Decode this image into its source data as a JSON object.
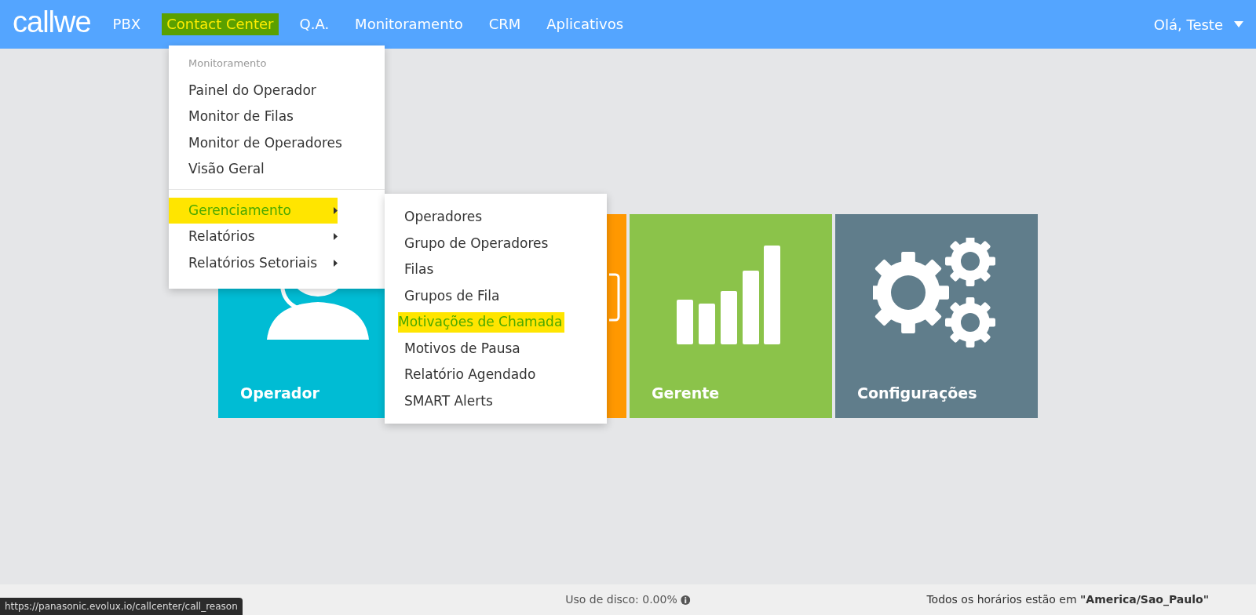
{
  "navbar": {
    "brand": "callwe",
    "items": [
      {
        "label": "PBX",
        "selected": false
      },
      {
        "label": "Contact Center",
        "selected": true
      },
      {
        "label": "Q.A.",
        "selected": false
      },
      {
        "label": "Monitoramento",
        "selected": false
      },
      {
        "label": "CRM",
        "selected": false
      },
      {
        "label": "Aplicativos",
        "selected": false
      }
    ],
    "user": "Olá, Teste"
  },
  "menu": {
    "header": "Monitoramento",
    "items": [
      {
        "label": "Painel do Operador",
        "selected": false,
        "submenu": false
      },
      {
        "label": "Monitor de Filas",
        "selected": false,
        "submenu": false
      },
      {
        "label": "Monitor de Operadores",
        "selected": false,
        "submenu": false
      },
      {
        "label": "Visão Geral",
        "selected": false,
        "submenu": false
      }
    ],
    "groups": [
      {
        "label": "Gerenciamento",
        "selected": true,
        "submenu": true
      },
      {
        "label": "Relatórios",
        "selected": false,
        "submenu": true
      },
      {
        "label": "Relatórios Setoriais",
        "selected": false,
        "submenu": true
      }
    ]
  },
  "submenu": {
    "items": [
      {
        "label": "Operadores",
        "selected": false
      },
      {
        "label": "Grupo de Operadores",
        "selected": false
      },
      {
        "label": "Filas",
        "selected": false
      },
      {
        "label": "Grupos de Fila",
        "selected": false
      },
      {
        "label": "Motivações de Chamada",
        "selected": true
      },
      {
        "label": "Motivos de Pausa",
        "selected": false
      },
      {
        "label": "Relatório Agendado",
        "selected": false
      },
      {
        "label": "SMART Alerts",
        "selected": false
      }
    ]
  },
  "tiles": [
    {
      "kind": "operator",
      "label": "Operador",
      "color": "#00bcd4"
    },
    {
      "kind": "screen",
      "color": "#ff9800"
    },
    {
      "kind": "chart",
      "label": "Gerente",
      "color": "#8bc34a"
    },
    {
      "kind": "gears",
      "label": "Configurações",
      "color": "#607d8b"
    }
  ],
  "footer": {
    "disk": "Uso de disco: 0.00%",
    "timezone": "Todos os horários estão em **\"America/Sao_Paulo\"**"
  },
  "status_url": "https://panasonic.evolux.io/callcenter/call_reason"
}
